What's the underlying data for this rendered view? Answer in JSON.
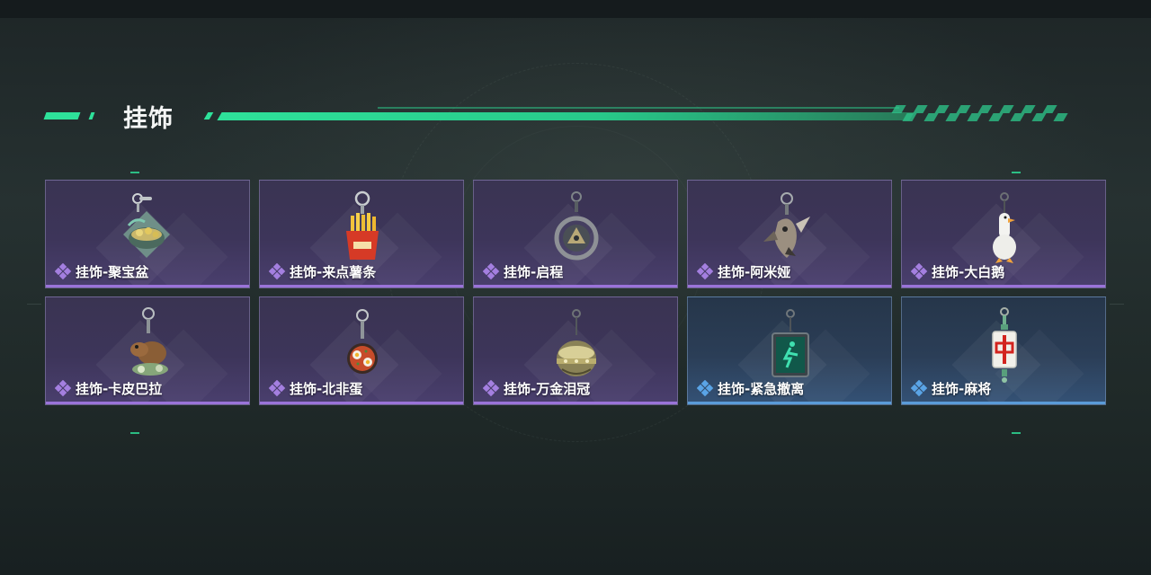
{
  "section": {
    "title": "挂饰"
  },
  "colors": {
    "accent": "#2ee19a",
    "rarity_purple": "#9a73d9",
    "rarity_blue": "#5a9bd8"
  },
  "items": [
    {
      "label": "挂饰-聚宝盆",
      "rarity": "purple",
      "icon": "treasure-bowl-charm-icon"
    },
    {
      "label": "挂饰-来点薯条",
      "rarity": "purple",
      "icon": "fries-charm-icon"
    },
    {
      "label": "挂饰-启程",
      "rarity": "purple",
      "icon": "medallion-charm-icon"
    },
    {
      "label": "挂饰-阿米娅",
      "rarity": "purple",
      "icon": "bird-charm-icon"
    },
    {
      "label": "挂饰-大白鹅",
      "rarity": "purple",
      "icon": "goose-charm-icon"
    },
    {
      "label": "挂饰-卡皮巴拉",
      "rarity": "purple",
      "icon": "capybara-charm-icon"
    },
    {
      "label": "挂饰-北非蛋",
      "rarity": "purple",
      "icon": "shakshuka-charm-icon"
    },
    {
      "label": "挂饰-万金泪冠",
      "rarity": "purple",
      "icon": "crown-charm-icon"
    },
    {
      "label": "挂饰-紧急撤离",
      "rarity": "blue",
      "icon": "exit-sign-charm-icon"
    },
    {
      "label": "挂饰-麻将",
      "rarity": "blue",
      "icon": "mahjong-tile-charm-icon"
    }
  ]
}
